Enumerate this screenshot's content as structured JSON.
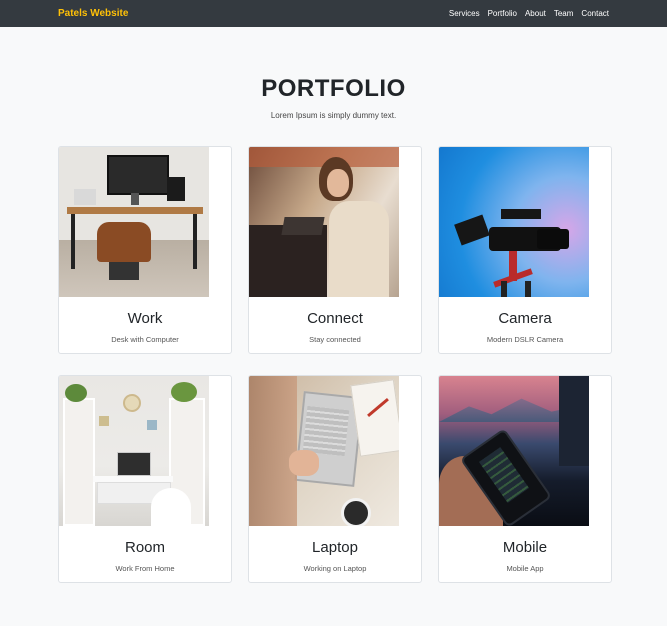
{
  "navbar": {
    "brand": "Patels Website",
    "links": [
      "Services",
      "Portfolio",
      "About",
      "Team",
      "Contact"
    ]
  },
  "header": {
    "title": "PORTFOLIO",
    "subtitle": "Lorem Ipsum is simply dummy text."
  },
  "cards": [
    {
      "title": "Work",
      "text": "Desk with Computer",
      "image": "desk-photo"
    },
    {
      "title": "Connect",
      "text": "Stay connected",
      "image": "woman-laptop-photo"
    },
    {
      "title": "Camera",
      "text": "Modern DSLR Camera",
      "image": "camera-photo"
    },
    {
      "title": "Room",
      "text": "Work From Home",
      "image": "room-photo"
    },
    {
      "title": "Laptop",
      "text": "Working on Laptop",
      "image": "laptop-photo"
    },
    {
      "title": "Mobile",
      "text": "Mobile App",
      "image": "mobile-photo"
    }
  ],
  "colors": {
    "navbar_bg": "#343a40",
    "brand": "#ffc107",
    "page_bg": "#f8f9fa"
  }
}
